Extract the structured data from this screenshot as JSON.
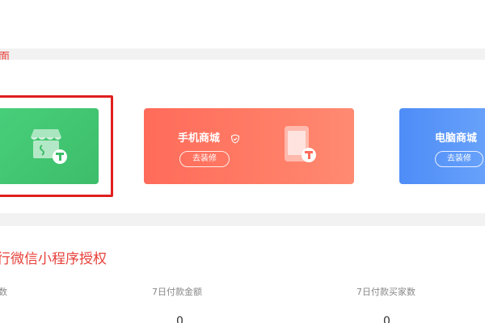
{
  "header": {
    "partial_title": "面"
  },
  "cards": {
    "mobile": {
      "title": "手机商城",
      "button": "去装修"
    },
    "pc": {
      "title": "电脑商城",
      "button": "去装修"
    }
  },
  "section": {
    "title": "行微信小程序授权",
    "stats": [
      {
        "label": "数",
        "value": ""
      },
      {
        "label": "7日付款金额",
        "value": "0"
      },
      {
        "label": "7日付款买家数",
        "value": "0"
      }
    ]
  },
  "colors": {
    "accent_red": "#e7413a",
    "mini_green": "#48cf7a",
    "mobile_orange": "#ff6b5a",
    "pc_blue": "#4e8cf7",
    "selected_border": "#e01f1f"
  }
}
